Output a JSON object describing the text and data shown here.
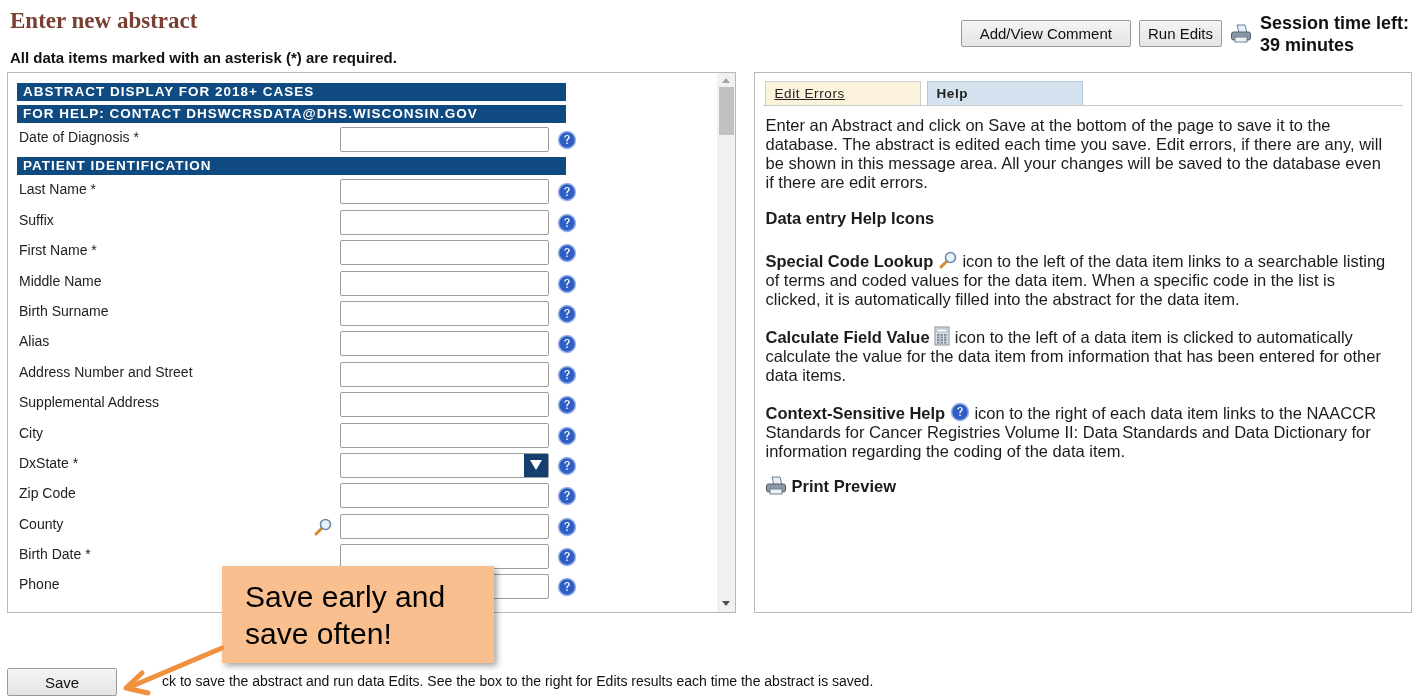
{
  "page": {
    "title": "Enter new abstract",
    "required_note": "All data items marked with an asterisk (*) are required."
  },
  "toolbar": {
    "buttons": [
      "Add/View Comment",
      "Run Edits"
    ],
    "session": "Session time left: 39 minutes"
  },
  "form": {
    "items": [
      {
        "kind": "heading",
        "text": "ABSTRACT DISPLAY FOR 2018+ CASES"
      },
      {
        "kind": "heading",
        "text": "FOR HELP: CONTACT DHSWCRSDATA@DHS.WISCONSIN.GOV"
      },
      {
        "kind": "text",
        "label": "Date of Diagnosis *"
      },
      {
        "kind": "heading",
        "text": "PATIENT IDENTIFICATION"
      },
      {
        "kind": "text",
        "label": "Last Name *"
      },
      {
        "kind": "text",
        "label": "Suffix"
      },
      {
        "kind": "text",
        "label": "First Name *"
      },
      {
        "kind": "text",
        "label": "Middle Name"
      },
      {
        "kind": "text",
        "label": "Birth Surname"
      },
      {
        "kind": "text",
        "label": "Alias"
      },
      {
        "kind": "text",
        "label": "Address Number and Street"
      },
      {
        "kind": "text",
        "label": "Supplemental Address"
      },
      {
        "kind": "text",
        "label": "City"
      },
      {
        "kind": "select",
        "label": "DxState *"
      },
      {
        "kind": "text",
        "label": "Zip Code"
      },
      {
        "kind": "lookup",
        "label": "County"
      },
      {
        "kind": "text",
        "label": "Birth Date *"
      },
      {
        "kind": "text",
        "label": "Phone"
      }
    ]
  },
  "help_panel": {
    "tabs": [
      {
        "label": "Edit Errors",
        "selected": false
      },
      {
        "label": "Help",
        "selected": true
      }
    ],
    "intro": "Enter an Abstract and click on Save at the bottom of the page to save it to the database. The abstract is edited each time you save. Edit errors, if there are any, will be shown in this message area. All your changes will be saved to the database even if there are edit errors.",
    "heading": "Data entry Help Icons",
    "entries": [
      {
        "kind": "lookup",
        "term": "Special Code Lookup",
        "text": "icon to the left of the data item links to a searchable listing of terms and coded values for the data item. When a specific code in the list is clicked, it is automatically filled into the abstract for the data item."
      },
      {
        "kind": "calculate",
        "term": "Calculate Field Value",
        "text": "icon to the left of a data item is clicked to automatically calculate the value for the data item from information that has been entered for other data items."
      },
      {
        "kind": "help",
        "term": "Context-Sensitive Help",
        "text": "icon to the right of each data item links to the NAACCR Standards for Cancer Registries Volume II: Data Standards and Data Dictionary for information regarding the coding of the data item."
      }
    ],
    "print_preview": "Print Preview"
  },
  "footer": {
    "save_button": "Save",
    "note": "ck to save the abstract and run data Edits. See the box to the right for Edits results each time the abstract is saved."
  },
  "callout": {
    "text": "Save early and save often!"
  }
}
